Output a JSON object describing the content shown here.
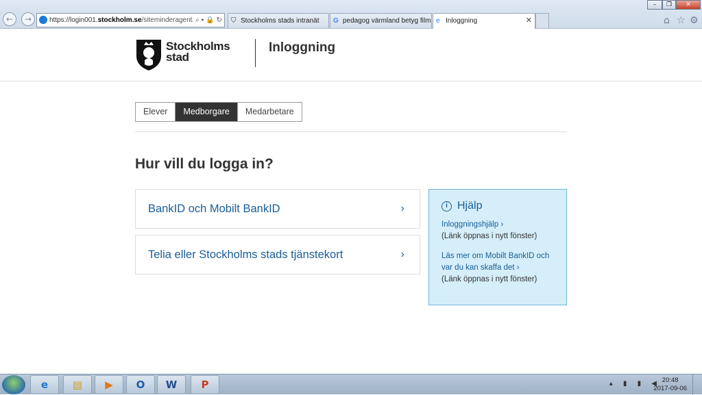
{
  "browser": {
    "address": {
      "prefix": "https://login001.",
      "domain": "stockholm.se",
      "tail": "/siteminderagent/for"
    },
    "tabs": [
      {
        "title": "Stockholms stads intranät"
      },
      {
        "title": "pedagog värmland betyg film ..."
      },
      {
        "title": "Inloggning"
      }
    ]
  },
  "header": {
    "logo_line1": "Stockholms",
    "logo_line2": "stad",
    "title": "Inloggning"
  },
  "segments": [
    {
      "label": "Elever"
    },
    {
      "label": "Medborgare"
    },
    {
      "label": "Medarbetare"
    }
  ],
  "heading": "Hur vill du logga in?",
  "options": [
    {
      "label": "BankID och Mobilt BankID"
    },
    {
      "label": "Telia eller Stockholms stads tjänstekort"
    }
  ],
  "help": {
    "title": "Hjälp",
    "link1": "Inloggningshjälp ›",
    "note1": "(Länk öppnas i nytt fönster)",
    "link2": "Läs mer om Mobilt BankID och var du kan skaffa det ›",
    "note2": "(Länk öppnas i nytt fönster)"
  },
  "taskbar": {
    "time": "20:48",
    "date": "2017-09-06"
  }
}
